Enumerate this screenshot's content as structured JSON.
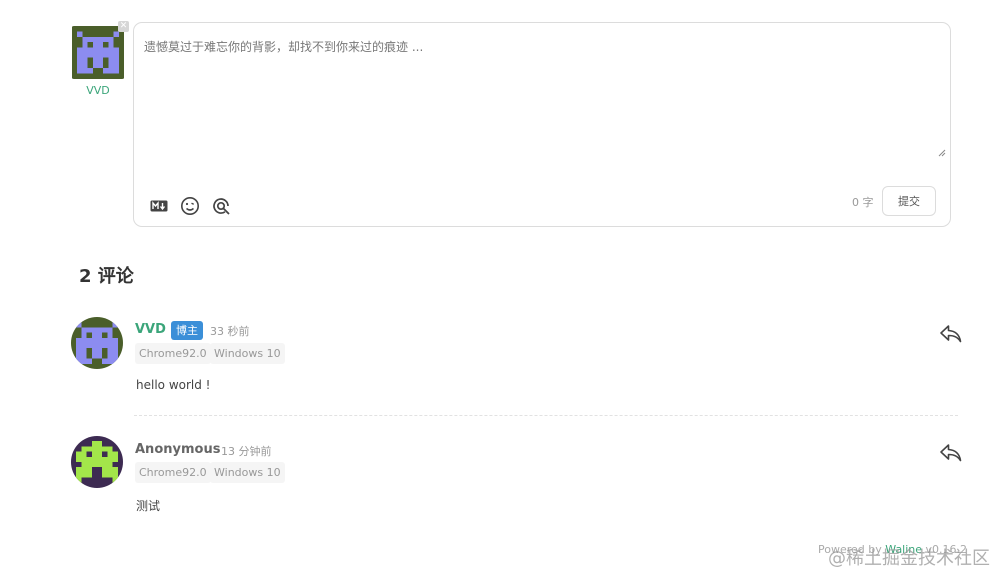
{
  "user": {
    "nick": "VVD",
    "logout_icon": "close-icon"
  },
  "editor": {
    "placeholder": "遗憾莫过于难忘你的背影，却找不到你来过的痕迹 ...",
    "value": "",
    "tools": [
      "markdown-icon",
      "emoji-icon",
      "preview-icon"
    ],
    "word_count": "0 字",
    "submit_label": "提交"
  },
  "comment_count_title": "2 评论",
  "comments": [
    {
      "nick": "VVD",
      "badge": "博主",
      "time": "33 秒前",
      "browser": "Chrome92.0",
      "os": "Windows 10",
      "content": "hello world !",
      "nick_color": "#3ba57a",
      "avatar_bg": "#4a5e2a",
      "avatar_fg": "#8c8cf0"
    },
    {
      "nick": "Anonymous",
      "badge": "",
      "time": "13 分钟前",
      "browser": "Chrome92.0",
      "os": "Windows 10",
      "content": "测试",
      "nick_color": "#666666",
      "avatar_bg": "#3d2b52",
      "avatar_fg": "#a3e64a"
    }
  ],
  "footer": {
    "prefix": "Powered by ",
    "link": "Waline",
    "version": " v0.16.2"
  },
  "watermark": "@稀土掘金技术社区",
  "colors": {
    "accent": "#3ba57a",
    "badge": "#3b8fd8"
  }
}
